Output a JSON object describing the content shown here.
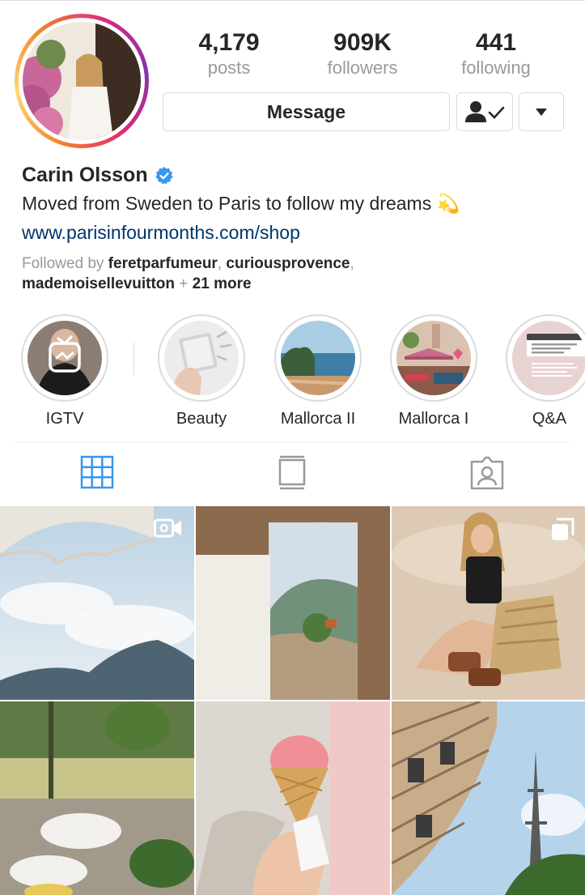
{
  "profile": {
    "username": "Carin Olsson",
    "verified": true,
    "bio": "Moved from Sweden to Paris to follow my dreams 💫",
    "website": "www.parisinfourmonths.com/shop",
    "followed_prefix": "Followed by ",
    "followed_users": [
      "feretparfumeur",
      "curiousprovence",
      "mademoisellevuitton"
    ],
    "followed_suffix_more": "21 more"
  },
  "stats": {
    "posts": {
      "value": "4,179",
      "label": "posts"
    },
    "followers": {
      "value": "909K",
      "label": "followers"
    },
    "following": {
      "value": "441",
      "label": "following"
    }
  },
  "actions": {
    "message_label": "Message"
  },
  "highlights": [
    {
      "label": "IGTV"
    },
    {
      "label": "Beauty"
    },
    {
      "label": "Mallorca II"
    },
    {
      "label": "Mallorca I"
    },
    {
      "label": "Q&A"
    }
  ],
  "tabs": [
    {
      "icon": "grid-icon",
      "active": true
    },
    {
      "icon": "feed-icon",
      "active": false
    },
    {
      "icon": "tagged-icon",
      "active": false
    }
  ],
  "colors": {
    "accent": "#3897f0",
    "link": "#003569",
    "muted": "#999999",
    "text": "#262626",
    "border": "#dbdbdb"
  }
}
